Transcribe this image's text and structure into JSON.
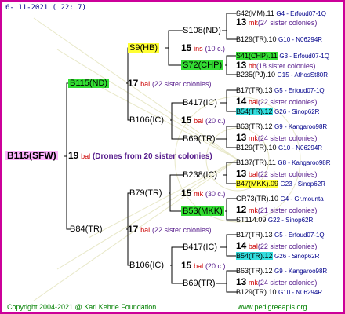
{
  "date": "6- 11-2021 ( 22: 7)",
  "copyright": "Copyright 2004-2021 @ Karl Kehrle Foundation",
  "website": "www.pedigreeapis.org",
  "root": {
    "label": "B115(SFW)",
    "drone_num": "19",
    "drone_unit": "bal",
    "drone_note": "(Drones from 20 sister colonies)"
  },
  "gen1": [
    {
      "label": "B115(ND)",
      "num": "17",
      "unit": "bal",
      "note": "(22 sister colonies)"
    },
    {
      "label": "B84(TR)",
      "num": "17",
      "unit": "bal",
      "note": "(22 sister colonies)"
    }
  ],
  "gen2": [
    {
      "label": "S9(HB)",
      "num": "15",
      "unit": "ins",
      "note": "(10 c.)"
    },
    {
      "label": "B106(IC)",
      "num": "15",
      "unit": "bal",
      "note": "(20 c.)"
    },
    {
      "label": "B79(TR)",
      "num": "15",
      "unit": "mk",
      "note": "(30 c.)"
    },
    {
      "label": "B106(IC)",
      "num": "15",
      "unit": "bal",
      "note": "(20 c.)"
    }
  ],
  "gen3": [
    {
      "label": "S108(ND)"
    },
    {
      "label": "S72(CHP)"
    },
    {
      "label": "B417(IC)"
    },
    {
      "label": "B69(TR)"
    },
    {
      "label": "B238(IC)"
    },
    {
      "label": "B53(MKK)"
    },
    {
      "label": "B417(IC)"
    },
    {
      "label": "B69(TR)"
    }
  ],
  "gen4": [
    {
      "queen": "S42(MM).11",
      "info": "G4 - Erfoud07-1Q",
      "num": "13",
      "unit": "mk",
      "note": "(24 sister colonies)",
      "drone": "B129(TR).10",
      "drone_info": "G10 - N06294R"
    },
    {
      "queen": "S41(CHP).11",
      "info": "G3 - Erfoud07-1Q",
      "num": "13",
      "unit": "hb",
      "note": "(18 sister colonies)",
      "drone": "B235(PJ).10",
      "drone_info": "G15 - AthosSt80R"
    },
    {
      "queen": "B17(TR).13",
      "info": "G5 - Erfoud07-1Q",
      "num": "14",
      "unit": "bal",
      "note": "(22 sister colonies)",
      "drone": "B54(TR).12",
      "drone_info": "G26 - Sinop62R"
    },
    {
      "queen": "B63(TR).12",
      "info": "G9 - Kangaroo98R",
      "num": "13",
      "unit": "mk",
      "note": "(24 sister colonies)",
      "drone": "B129(TR).10",
      "drone_info": "G10 - N06294R"
    },
    {
      "queen": "B137(TR).11",
      "info": "G8 - Kangaroo98R",
      "num": "13",
      "unit": "bal",
      "note": "(22 sister colonies)",
      "drone": "B47(MKK).09",
      "drone_info": "G23 - Sinop62R"
    },
    {
      "queen": "GR73(TR).10",
      "info": "G4 - Gr.mounta",
      "num": "12",
      "unit": "mk",
      "note": "(21 sister colonies)",
      "drone": "ST114.09",
      "drone_info": "G22 - Sinop62R"
    },
    {
      "queen": "B17(TR).13",
      "info": "G5 - Erfoud07-1Q",
      "num": "14",
      "unit": "bal",
      "note": "(22 sister colonies)",
      "drone": "B54(TR).12",
      "drone_info": "G26 - Sinop62R"
    },
    {
      "queen": "B63(TR).12",
      "info": "G9 - Kangaroo98R",
      "num": "13",
      "unit": "mk",
      "note": "(24 sister colonies)",
      "drone": "B129(TR).10",
      "drone_info": "G10 - N06294R"
    }
  ],
  "colors": {
    "border": "#cc0099",
    "root_highlight": "#ffb3ff",
    "green_highlight": "#33dd33",
    "yellow_highlight": "#ffff33",
    "cyan_highlight": "#33dddd",
    "red_text": "#cc0000",
    "blue_text": "#00008b",
    "purple_text": "#551a8b"
  }
}
